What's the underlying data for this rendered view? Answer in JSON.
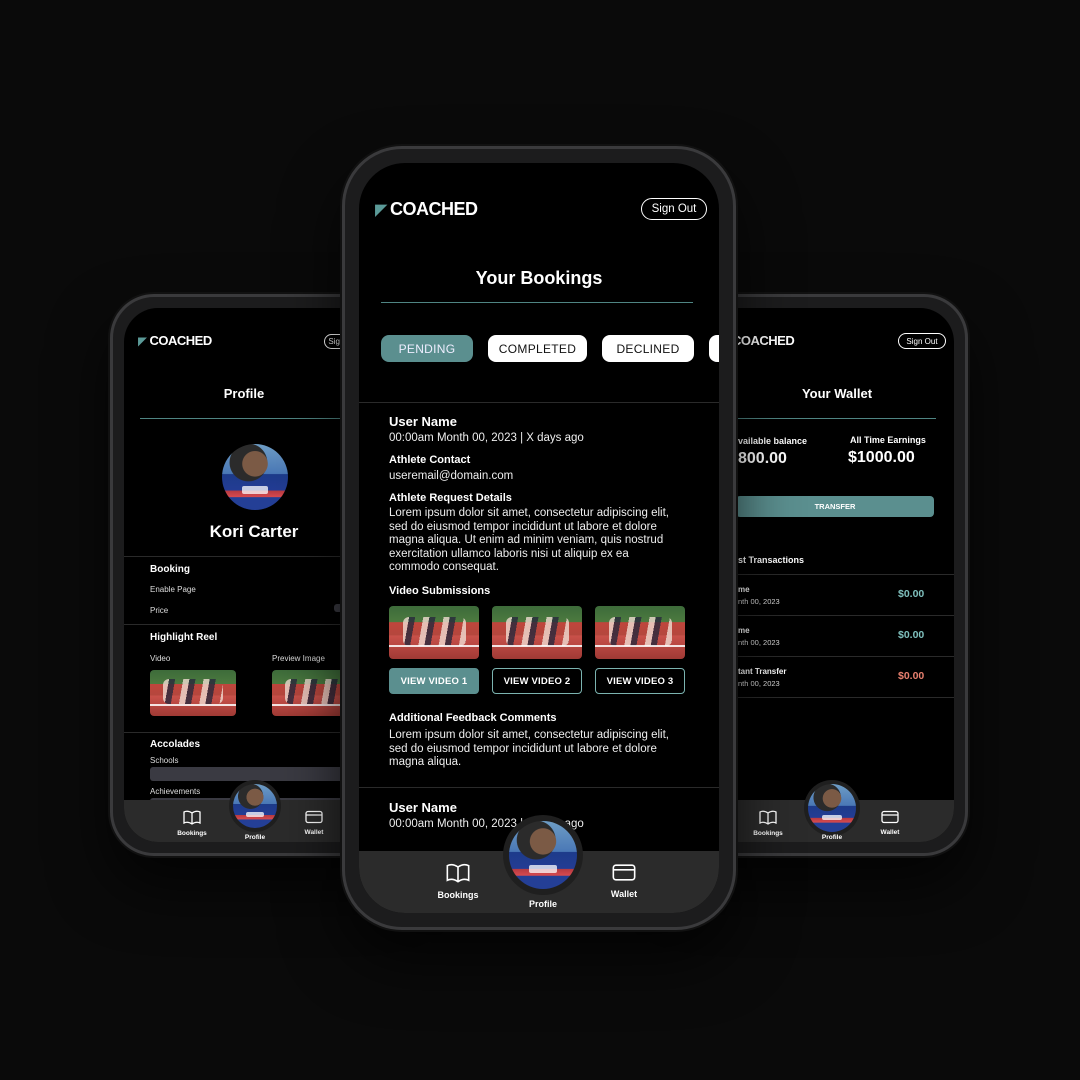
{
  "brand": {
    "logo_text": "COACHED",
    "accent": "#5b8f8f"
  },
  "header": {
    "sign_out_label": "Sign Out"
  },
  "nav": {
    "bookings": "Bookings",
    "profile": "Profile",
    "wallet": "Wallet"
  },
  "profile_screen": {
    "title": "Profile",
    "name": "Kori Carter",
    "booking": {
      "heading": "Booking",
      "enable_page": "Enable Page",
      "price": "Price"
    },
    "highlight": {
      "heading": "Highlight Reel",
      "video": "Video",
      "preview_image": "Preview Image"
    },
    "accolades": {
      "heading": "Accolades",
      "schools": "Schools",
      "achievements": "Achievements"
    }
  },
  "bookings_screen": {
    "title": "Your Bookings",
    "tabs": [
      "PENDING",
      "COMPLETED",
      "DECLINED"
    ],
    "booking": {
      "user_name": "User Name",
      "datetime": "00:00am Month 00, 2023 | X days ago",
      "contact_label": "Athlete Contact",
      "email": "useremail@domain.com",
      "details_label": "Athlete Request Details",
      "details_text": "Lorem ipsum dolor sit amet, consectetur adipiscing elit, sed do eiusmod tempor incididunt ut labore et dolore magna aliqua. Ut enim ad minim veniam, quis nostrud exercitation ullamco laboris nisi ut aliquip ex ea commodo consequat.",
      "videos_label": "Video Submissions",
      "video_buttons": [
        "VIEW VIDEO 1",
        "VIEW VIDEO 2",
        "VIEW VIDEO 3"
      ],
      "feedback_label": "Additional Feedback Comments",
      "feedback_text": "Lorem ipsum dolor sit amet, consectetur adipiscing elit, sed do eiusmod tempor incididunt ut labore et dolore magna aliqua."
    },
    "next_booking": {
      "user_name": "User Name",
      "datetime": "00:00am Month 00, 2023 | X days ago"
    }
  },
  "wallet_screen": {
    "title": "Your Wallet",
    "available_label": "vailable balance",
    "available_value": "800.00",
    "earnings_label": "All Time Earnings",
    "earnings_value": "$1000.00",
    "transfer_label": "TRANSFER",
    "transactions_heading": "st Transactions",
    "transactions": [
      {
        "name": "me",
        "date": "nth 00, 2023",
        "amount": "$0.00",
        "color": "#7fc0bd"
      },
      {
        "name": "me",
        "date": "nth 00, 2023",
        "amount": "$0.00",
        "color": "#7fc0bd"
      },
      {
        "name": "tant Transfer",
        "date": "nth 00, 2023",
        "amount": "$0.00",
        "color": "#e8806f"
      }
    ]
  }
}
